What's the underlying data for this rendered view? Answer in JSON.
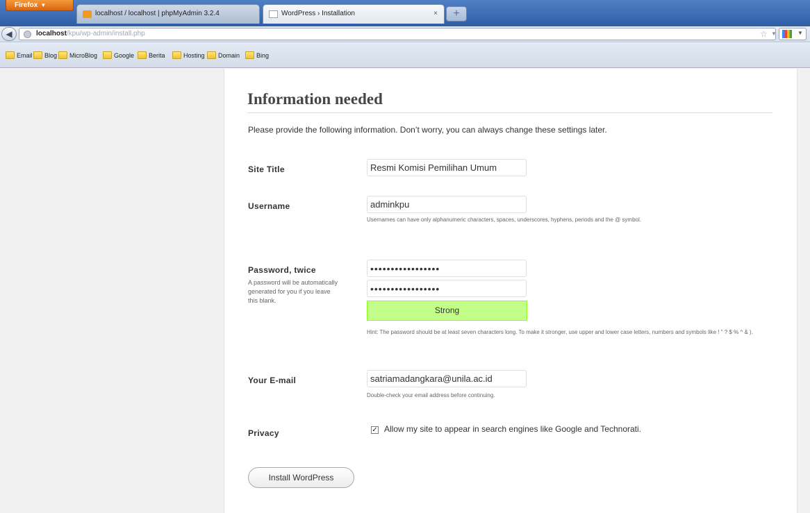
{
  "browser": {
    "menu_button": "Firefox",
    "tabs": [
      {
        "label": "localhost / localhost | phpMyAdmin 3.2.4",
        "active": false
      },
      {
        "label": "WordPress › Installation",
        "active": true
      }
    ],
    "new_tab_symbol": "+",
    "tab_close_symbol": "×",
    "url_domain": "localhost",
    "url_path": "/kpu/wp-admin/install.php",
    "bookmarks": [
      "Email",
      "Blog",
      "MicroBlog",
      "Google",
      "Berita",
      "Hosting",
      "Domain",
      "Bing"
    ]
  },
  "page": {
    "heading": "Information needed",
    "intro": "Please provide the following information. Don’t worry, you can always change these settings later.",
    "site_title": {
      "label": "Site Title",
      "value": "Resmi Komisi Pemilihan Umum"
    },
    "username": {
      "label": "Username",
      "value": "adminkpu",
      "hint": "Usernames can have only alphanumeric characters, spaces, underscores, hyphens, periods and the @ symbol."
    },
    "password": {
      "label": "Password, twice",
      "sublabel": "A password will be automatically generated for you if you leave this blank.",
      "value_1": "•••••••••••••••••",
      "value_2": "•••••••••••••••••",
      "strength": "Strong",
      "hint": "Hint: The password should be at least seven characters long. To make it stronger, use upper and lower case letters, numbers and symbols like ! \" ? $ % ^ & )."
    },
    "email": {
      "label": "Your E-mail",
      "value": "satriamadangkara@unila.ac.id",
      "hint": "Double-check your email address before continuing."
    },
    "privacy": {
      "label": "Privacy",
      "checked": true,
      "check_mark": "✓",
      "text": "Allow my site to appear in search engines like Google and Technorati."
    },
    "install_button": "Install WordPress"
  },
  "colors": {
    "strength_bg": "#c3ff88",
    "page_bg": "#f1f1f1",
    "panel_bg": "#ffffff"
  }
}
